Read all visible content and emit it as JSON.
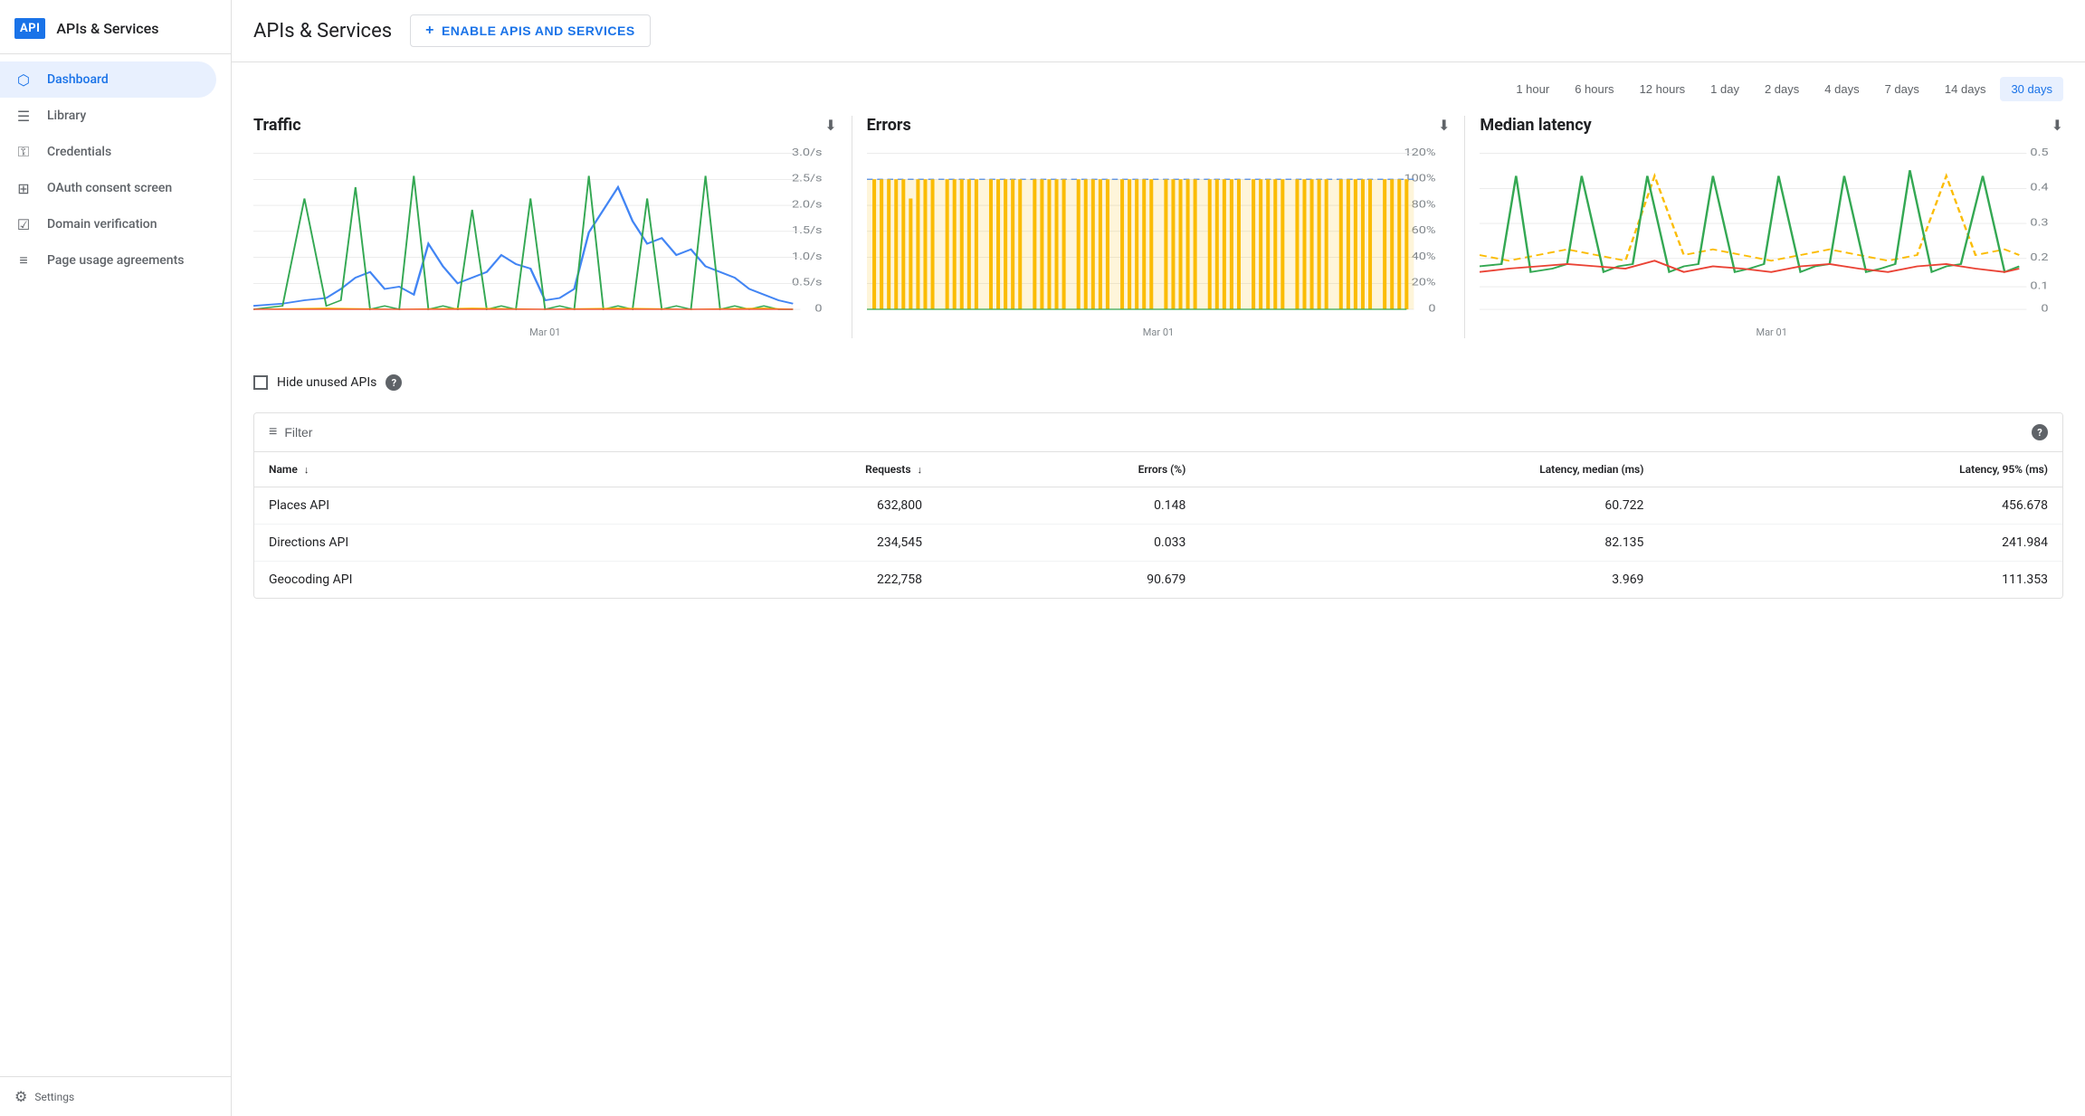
{
  "sidebar": {
    "logo": "API",
    "title": "APIs & Services",
    "nav_items": [
      {
        "id": "dashboard",
        "label": "Dashboard",
        "icon": "⬡",
        "active": true
      },
      {
        "id": "library",
        "label": "Library",
        "icon": "☰",
        "active": false
      },
      {
        "id": "credentials",
        "label": "Credentials",
        "icon": "⚿",
        "active": false
      },
      {
        "id": "oauth",
        "label": "OAuth consent screen",
        "icon": "⊞",
        "active": false
      },
      {
        "id": "domain",
        "label": "Domain verification",
        "icon": "☑",
        "active": false
      },
      {
        "id": "page-usage",
        "label": "Page usage agreements",
        "icon": "≡",
        "active": false
      }
    ]
  },
  "header": {
    "title": "APIs & Services",
    "enable_btn": "ENABLE APIS AND SERVICES"
  },
  "time_range": {
    "options": [
      {
        "id": "1hour",
        "label": "1 hour",
        "active": false
      },
      {
        "id": "6hours",
        "label": "6 hours",
        "active": false
      },
      {
        "id": "12hours",
        "label": "12 hours",
        "active": false
      },
      {
        "id": "1day",
        "label": "1 day",
        "active": false
      },
      {
        "id": "2days",
        "label": "2 days",
        "active": false
      },
      {
        "id": "4days",
        "label": "4 days",
        "active": false
      },
      {
        "id": "7days",
        "label": "7 days",
        "active": false
      },
      {
        "id": "14days",
        "label": "14 days",
        "active": false
      },
      {
        "id": "30days",
        "label": "30 days",
        "active": true
      }
    ]
  },
  "charts": {
    "traffic": {
      "title": "Traffic",
      "x_label": "Mar 01",
      "y_labels": [
        "3.0/s",
        "2.5/s",
        "2.0/s",
        "1.5/s",
        "1.0/s",
        "0.5/s",
        "0"
      ]
    },
    "errors": {
      "title": "Errors",
      "x_label": "Mar 01",
      "y_labels": [
        "120%",
        "100%",
        "80%",
        "60%",
        "40%",
        "20%",
        "0"
      ]
    },
    "latency": {
      "title": "Median latency",
      "x_label": "Mar 01",
      "y_labels": [
        "0.5",
        "0.4",
        "0.3",
        "0.2",
        "0.1",
        "0"
      ]
    }
  },
  "hide_unused": {
    "label": "Hide unused APIs",
    "checked": false
  },
  "table": {
    "filter_label": "Filter",
    "help_icon": "?",
    "columns": [
      {
        "id": "name",
        "label": "Name",
        "sortable": true
      },
      {
        "id": "requests",
        "label": "Requests",
        "sortable": true,
        "align": "right"
      },
      {
        "id": "errors",
        "label": "Errors (%)",
        "sortable": false,
        "align": "right"
      },
      {
        "id": "latency_median",
        "label": "Latency, median (ms)",
        "sortable": false,
        "align": "right"
      },
      {
        "id": "latency_95",
        "label": "Latency, 95% (ms)",
        "sortable": false,
        "align": "right"
      }
    ],
    "rows": [
      {
        "name": "Places API",
        "requests": "632,800",
        "errors": "0.148",
        "latency_median": "60.722",
        "latency_95": "456.678"
      },
      {
        "name": "Directions API",
        "requests": "234,545",
        "errors": "0.033",
        "latency_median": "82.135",
        "latency_95": "241.984"
      },
      {
        "name": "Geocoding API",
        "requests": "222,758",
        "errors": "90.679",
        "latency_median": "3.969",
        "latency_95": "111.353"
      }
    ]
  }
}
